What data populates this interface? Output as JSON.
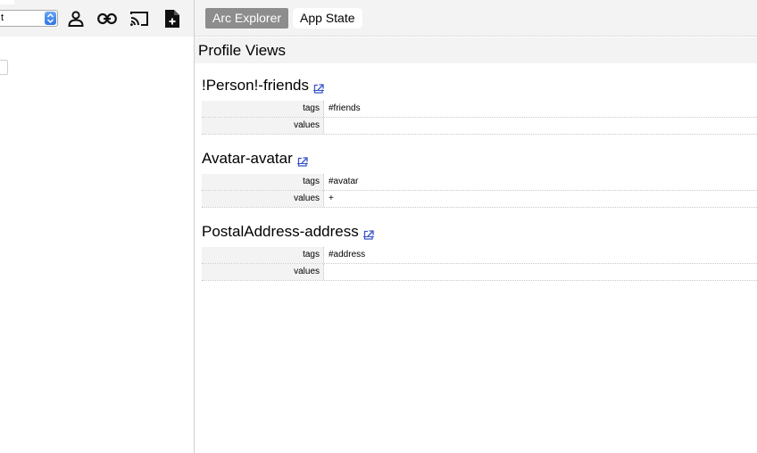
{
  "left": {
    "selector": {
      "value": "t"
    },
    "toolbar": {
      "icons": [
        "person-icon",
        "link-icon",
        "cast-icon",
        "add-file-icon"
      ]
    }
  },
  "top_bar": {
    "tabs": [
      {
        "label": "Arc Explorer",
        "active": true
      },
      {
        "label": "App State",
        "active": false
      }
    ]
  },
  "main": {
    "section_title": "Profile Views",
    "entries": [
      {
        "title": "!Person!-friends",
        "rows": [
          {
            "key": "tags",
            "value": "#friends"
          },
          {
            "key": "values",
            "value": ""
          }
        ]
      },
      {
        "title": "Avatar-avatar",
        "rows": [
          {
            "key": "tags",
            "value": "#avatar"
          },
          {
            "key": "values",
            "value": "+"
          }
        ]
      },
      {
        "title": "PostalAddress-address",
        "rows": [
          {
            "key": "tags",
            "value": "#address"
          },
          {
            "key": "values",
            "value": ""
          }
        ]
      }
    ]
  },
  "colors": {
    "toolbar_bg": "#f3f3f3",
    "active_tab_bg": "#8d8d8d",
    "link_icon": "#3a55c8",
    "select_accent": "#2f76e3"
  }
}
